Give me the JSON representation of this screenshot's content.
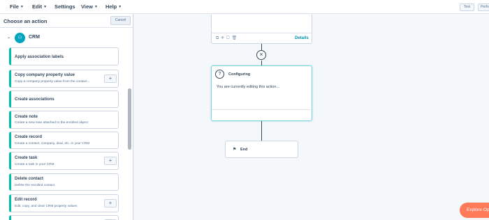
{
  "menubar": {
    "items": [
      {
        "label": "File",
        "has_caret": true
      },
      {
        "label": "Edit",
        "has_caret": true
      },
      {
        "label": "Settings",
        "has_caret": false
      },
      {
        "label": "View",
        "has_caret": true
      },
      {
        "label": "Help",
        "has_caret": true
      }
    ],
    "test_label": "Test",
    "perf_label": "Perfo"
  },
  "panel": {
    "title": "Choose an action",
    "cancel_label": "Cancel",
    "section": {
      "label": "CRM",
      "icon": "crm-people-icon"
    },
    "actions": [
      {
        "title": "Apply association labels",
        "desc": "",
        "has_plus": false
      },
      {
        "title": "Copy company property value",
        "desc": "Copy a company property value from the contact...",
        "has_plus": true
      },
      {
        "title": "Create associations",
        "desc": "",
        "has_plus": false
      },
      {
        "title": "Create note",
        "desc": "Create a new note attached to the enrolled object",
        "has_plus": false
      },
      {
        "title": "Create record",
        "desc": "Create a contact, company, deal, etc. in your CRM",
        "has_plus": false
      },
      {
        "title": "Create task",
        "desc": "Create a task in your CRM",
        "has_plus": true
      },
      {
        "title": "Delete contact",
        "desc": "Delete the enrolled contact",
        "has_plus": false
      },
      {
        "title": "Edit record",
        "desc": "Edit, copy, and clear CRM property values",
        "has_plus": true
      },
      {
        "title": "",
        "desc": "",
        "has_plus": true
      }
    ],
    "plus_symbol": "+"
  },
  "canvas": {
    "top_node": {
      "details_label": "Details",
      "icons": [
        "copy-icon",
        "move-icon",
        "clipboard-icon",
        "trash-icon"
      ]
    },
    "configuring": {
      "title": "Configuring",
      "body": "You are currently editing this action..."
    },
    "end_node": {
      "label": "End"
    }
  },
  "explore_button": {
    "label": "Explore Opt"
  },
  "colors": {
    "accent": "#00bda5",
    "link": "#0091ae",
    "cta": "#ff7a59"
  }
}
